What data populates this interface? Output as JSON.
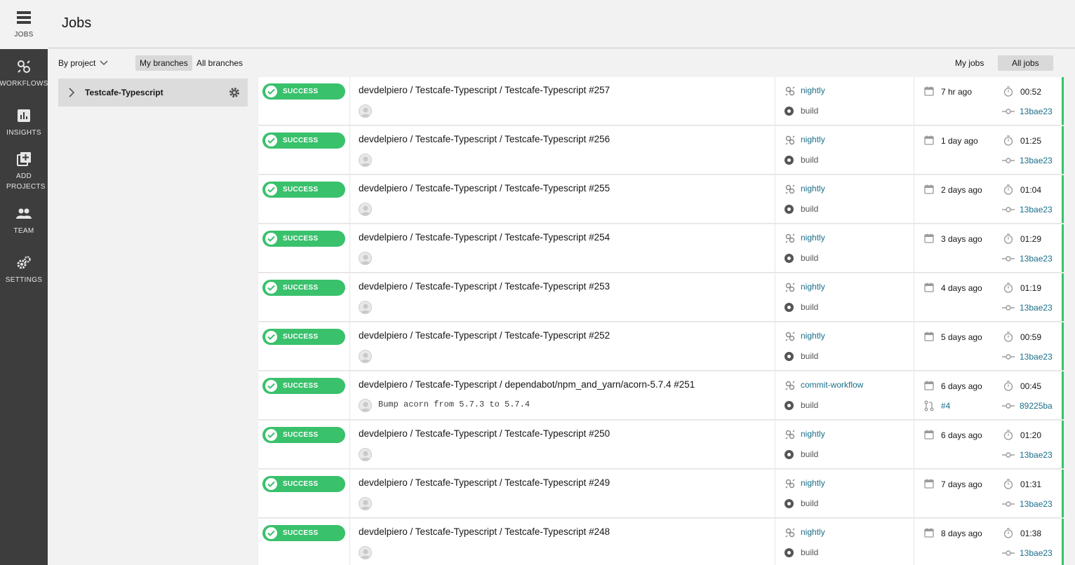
{
  "nav": {
    "items": [
      {
        "label": "JOBS",
        "icon": "jobs-icon"
      },
      {
        "label": "WORKFLOWS",
        "icon": "workflows-icon"
      },
      {
        "label": "INSIGHTS",
        "icon": "insights-icon"
      },
      {
        "label": "ADD PROJECTS",
        "icon": "add-projects-icon"
      },
      {
        "label": "TEAM",
        "icon": "team-icon"
      },
      {
        "label": "SETTINGS",
        "icon": "settings-icon"
      }
    ]
  },
  "header": {
    "title": "Jobs"
  },
  "filters": {
    "by_project": "By project",
    "my_branches": "My branches",
    "all_branches": "All branches",
    "my_jobs": "My jobs",
    "all_jobs": "All jobs"
  },
  "project": {
    "name": "Testcafe-Typescript"
  },
  "colors": {
    "success": "#39c16c",
    "link": "#1a6f8a",
    "nav_bg": "#3d3d3d"
  },
  "jobs": [
    {
      "status": "SUCCESS",
      "title": "devdelpiero / Testcafe-Typescript / Testcafe-Typescript #257",
      "commit_msg": "",
      "workflow": "nightly",
      "job_name": "build",
      "date": "7 hr ago",
      "duration": "00:52",
      "pr": "",
      "sha": "13bae23"
    },
    {
      "status": "SUCCESS",
      "title": "devdelpiero / Testcafe-Typescript / Testcafe-Typescript #256",
      "commit_msg": "",
      "workflow": "nightly",
      "job_name": "build",
      "date": "1 day ago",
      "duration": "01:25",
      "pr": "",
      "sha": "13bae23"
    },
    {
      "status": "SUCCESS",
      "title": "devdelpiero / Testcafe-Typescript / Testcafe-Typescript #255",
      "commit_msg": "",
      "workflow": "nightly",
      "job_name": "build",
      "date": "2 days ago",
      "duration": "01:04",
      "pr": "",
      "sha": "13bae23"
    },
    {
      "status": "SUCCESS",
      "title": "devdelpiero / Testcafe-Typescript / Testcafe-Typescript #254",
      "commit_msg": "",
      "workflow": "nightly",
      "job_name": "build",
      "date": "3 days ago",
      "duration": "01:29",
      "pr": "",
      "sha": "13bae23"
    },
    {
      "status": "SUCCESS",
      "title": "devdelpiero / Testcafe-Typescript / Testcafe-Typescript #253",
      "commit_msg": "",
      "workflow": "nightly",
      "job_name": "build",
      "date": "4 days ago",
      "duration": "01:19",
      "pr": "",
      "sha": "13bae23"
    },
    {
      "status": "SUCCESS",
      "title": "devdelpiero / Testcafe-Typescript / Testcafe-Typescript #252",
      "commit_msg": "",
      "workflow": "nightly",
      "job_name": "build",
      "date": "5 days ago",
      "duration": "00:59",
      "pr": "",
      "sha": "13bae23"
    },
    {
      "status": "SUCCESS",
      "title": "devdelpiero / Testcafe-Typescript / dependabot/npm_and_yarn/acorn-5.7.4 #251",
      "commit_msg": "Bump acorn from 5.7.3 to 5.7.4",
      "workflow": "commit-workflow",
      "job_name": "build",
      "date": "6 days ago",
      "duration": "00:45",
      "pr": "#4",
      "sha": "89225ba"
    },
    {
      "status": "SUCCESS",
      "title": "devdelpiero / Testcafe-Typescript / Testcafe-Typescript #250",
      "commit_msg": "",
      "workflow": "nightly",
      "job_name": "build",
      "date": "6 days ago",
      "duration": "01:20",
      "pr": "",
      "sha": "13bae23"
    },
    {
      "status": "SUCCESS",
      "title": "devdelpiero / Testcafe-Typescript / Testcafe-Typescript #249",
      "commit_msg": "",
      "workflow": "nightly",
      "job_name": "build",
      "date": "7 days ago",
      "duration": "01:31",
      "pr": "",
      "sha": "13bae23"
    },
    {
      "status": "SUCCESS",
      "title": "devdelpiero / Testcafe-Typescript / Testcafe-Typescript #248",
      "commit_msg": "",
      "workflow": "nightly",
      "job_name": "build",
      "date": "8 days ago",
      "duration": "01:38",
      "pr": "",
      "sha": "13bae23"
    }
  ]
}
